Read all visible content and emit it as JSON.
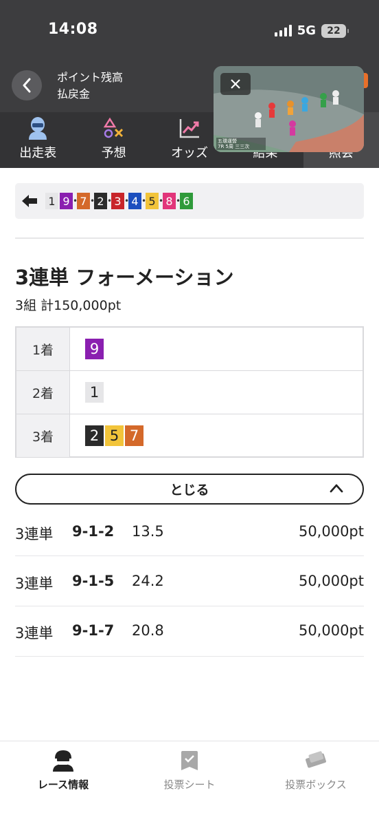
{
  "status_bar": {
    "time": "14:08",
    "network": "5G",
    "battery": "22"
  },
  "header": {
    "balance_label": "ポイント残高",
    "refund_label": "払戻金"
  },
  "tabs": [
    {
      "label": "出走表",
      "icon": "racer-icon"
    },
    {
      "label": "予想",
      "icon": "prediction-icon"
    },
    {
      "label": "オッズ",
      "icon": "odds-chart-icon"
    },
    {
      "label": "結果",
      "icon": "result-icon"
    },
    {
      "label": "照会",
      "icon": "inquiry-icon"
    }
  ],
  "video": {
    "caption_1": "五環運營",
    "caption_2": "7R 5周 三三次"
  },
  "result_order": [
    {
      "num": "1",
      "bg": "#e6e6e8",
      "fg": "#222222"
    },
    {
      "num": "9",
      "bg": "#8a1fb0",
      "fg": "#ffffff"
    },
    {
      "num": "7",
      "bg": "#d4692a",
      "fg": "#ffffff"
    },
    {
      "num": "2",
      "bg": "#2b2b2b",
      "fg": "#ffffff"
    },
    {
      "num": "3",
      "bg": "#c8252a",
      "fg": "#ffffff"
    },
    {
      "num": "4",
      "bg": "#1c4fbf",
      "fg": "#ffffff"
    },
    {
      "num": "5",
      "bg": "#f2c43a",
      "fg": "#222222"
    },
    {
      "num": "8",
      "bg": "#e2357a",
      "fg": "#ffffff"
    },
    {
      "num": "6",
      "bg": "#2f9a3a",
      "fg": "#ffffff"
    }
  ],
  "bet": {
    "title": "3連単 フォーメーション",
    "summary": "3組 計150,000pt",
    "rows": [
      {
        "label": "1着",
        "picks": [
          {
            "num": "9",
            "bg": "#8a1fb0",
            "fg": "#ffffff"
          }
        ]
      },
      {
        "label": "2着",
        "picks": [
          {
            "num": "1",
            "bg": "#e6e6e8",
            "fg": "#222222"
          }
        ]
      },
      {
        "label": "3着",
        "picks": [
          {
            "num": "2",
            "bg": "#2b2b2b",
            "fg": "#ffffff"
          },
          {
            "num": "5",
            "bg": "#f2c43a",
            "fg": "#222222"
          },
          {
            "num": "7",
            "bg": "#d4692a",
            "fg": "#ffffff"
          }
        ]
      }
    ],
    "close_label": "とじる",
    "lines": [
      {
        "type": "3連単",
        "combo": "9-1-2",
        "odds": "13.5",
        "amount": "50,000pt"
      },
      {
        "type": "3連単",
        "combo": "9-1-5",
        "odds": "24.2",
        "amount": "50,000pt"
      },
      {
        "type": "3連単",
        "combo": "9-1-7",
        "odds": "20.8",
        "amount": "50,000pt"
      }
    ]
  },
  "bottom_nav": [
    {
      "label": "レース情報",
      "icon": "race-info-icon",
      "active": true
    },
    {
      "label": "投票シート",
      "icon": "vote-sheet-icon",
      "active": false
    },
    {
      "label": "投票ボックス",
      "icon": "vote-box-icon",
      "active": false
    }
  ]
}
